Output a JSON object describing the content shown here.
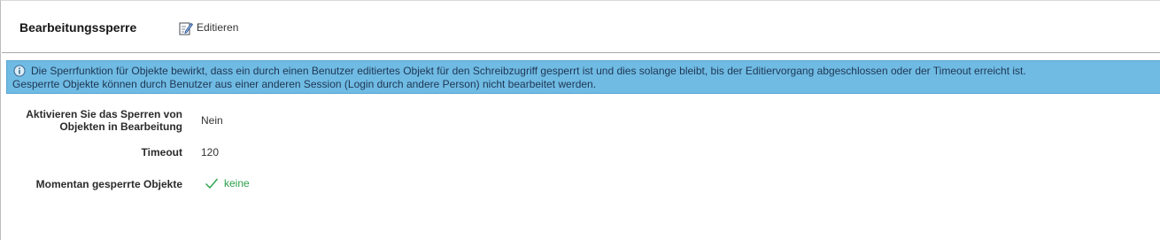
{
  "header": {
    "title": "Bearbeitungssperre",
    "edit_label": "Editieren"
  },
  "info": {
    "line1": "Die Sperrfunktion für Objekte bewirkt, dass ein durch einen Benutzer editiertes Objekt für den Schreibzugriff gesperrt ist und dies solange bleibt, bis der Editiervorgang abgeschlossen oder der Timeout erreicht ist.",
    "line2": "Gesperrte Objekte können durch Benutzer aus einer anderen Session (Login durch andere Person) nicht bearbeitet werden."
  },
  "form": {
    "locking": {
      "label_line1": "Aktivieren Sie das Sperren von",
      "label_line2": "Objekten in Bearbeitung",
      "value": "Nein"
    },
    "timeout": {
      "label": "Timeout",
      "value": "120"
    },
    "locked_objects": {
      "label": "Momentan gesperrte Objekte",
      "value": "keine",
      "status_icon": "check-icon",
      "status_color": "#2aa14a"
    }
  },
  "colors": {
    "info_background": "#6fbbe4",
    "info_text": "#1f3652"
  }
}
